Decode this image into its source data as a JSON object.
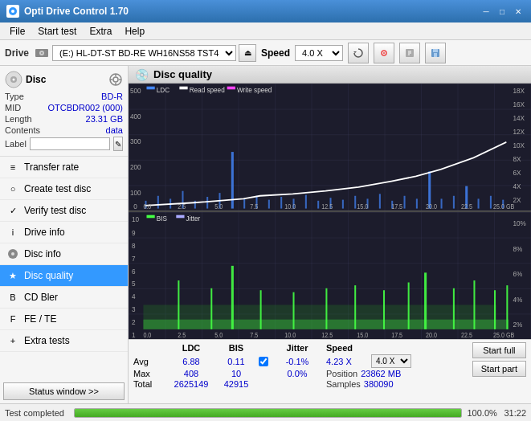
{
  "titlebar": {
    "title": "Opti Drive Control 1.70",
    "controls": [
      "minimize",
      "maximize",
      "close"
    ]
  },
  "menubar": {
    "items": [
      "File",
      "Start test",
      "Extra",
      "Help"
    ]
  },
  "drivebar": {
    "label": "Drive",
    "drive_value": "(E:)  HL-DT-ST BD-RE  WH16NS58 TST4",
    "speed_label": "Speed",
    "speed_value": "4.0 X"
  },
  "disc": {
    "title": "Disc",
    "type_label": "Type",
    "type_value": "BD-R",
    "mid_label": "MID",
    "mid_value": "OTCBDR002 (000)",
    "length_label": "Length",
    "length_value": "23.31 GB",
    "contents_label": "Contents",
    "contents_value": "data",
    "label_label": "Label"
  },
  "nav": {
    "items": [
      {
        "id": "transfer-rate",
        "label": "Transfer rate",
        "icon": "≡"
      },
      {
        "id": "create-test-disc",
        "label": "Create test disc",
        "icon": "○"
      },
      {
        "id": "verify-test-disc",
        "label": "Verify test disc",
        "icon": "✓"
      },
      {
        "id": "drive-info",
        "label": "Drive info",
        "icon": "i"
      },
      {
        "id": "disc-info",
        "label": "Disc info",
        "icon": "💿"
      },
      {
        "id": "disc-quality",
        "label": "Disc quality",
        "icon": "★",
        "active": true
      },
      {
        "id": "cd-bler",
        "label": "CD Bler",
        "icon": "B"
      },
      {
        "id": "fe-te",
        "label": "FE / TE",
        "icon": "F"
      },
      {
        "id": "extra-tests",
        "label": "Extra tests",
        "icon": "+"
      }
    ],
    "status_btn": "Status window >>"
  },
  "chart": {
    "title": "Disc quality",
    "top_legend": [
      {
        "label": "LDC",
        "color": "#4488ff"
      },
      {
        "label": "Read speed",
        "color": "#ffffff"
      },
      {
        "label": "Write speed",
        "color": "#ff44ff"
      }
    ],
    "bottom_legend": [
      {
        "label": "BIS",
        "color": "#44ff44"
      },
      {
        "label": "Jitter",
        "color": "transparent"
      }
    ],
    "top_y_left": [
      "500",
      "400",
      "300",
      "200",
      "100",
      "0"
    ],
    "top_y_right": [
      "18X",
      "16X",
      "14X",
      "12X",
      "10X",
      "8X",
      "6X",
      "4X",
      "2X"
    ],
    "bottom_y_left": [
      "10",
      "9",
      "8",
      "7",
      "6",
      "5",
      "4",
      "3",
      "2",
      "1"
    ],
    "bottom_y_right": [
      "10%",
      "8%",
      "6%",
      "4%",
      "2%"
    ],
    "x_labels": [
      "0.0",
      "2.5",
      "5.0",
      "7.5",
      "10.0",
      "12.5",
      "15.0",
      "17.5",
      "20.0",
      "22.5",
      "25.0 GB"
    ]
  },
  "stats": {
    "col_ldc": "LDC",
    "col_bis": "BIS",
    "col_jitter": "Jitter",
    "col_speed": "Speed",
    "row_avg": "Avg",
    "row_max": "Max",
    "row_total": "Total",
    "avg_ldc": "6.88",
    "avg_bis": "0.11",
    "avg_jitter": "-0.1%",
    "max_ldc": "408",
    "max_bis": "10",
    "max_jitter": "0.0%",
    "total_ldc": "2625149",
    "total_bis": "42915",
    "speed_val": "4.23 X",
    "speed_select": "4.0 X",
    "position_label": "Position",
    "position_val": "23862 MB",
    "samples_label": "Samples",
    "samples_val": "380090",
    "jitter_checked": true,
    "btn_start_full": "Start full",
    "btn_start_part": "Start part"
  },
  "progressbar": {
    "status": "Test completed",
    "percent": "100.0%",
    "time": "31:22",
    "fill_width": 100
  }
}
